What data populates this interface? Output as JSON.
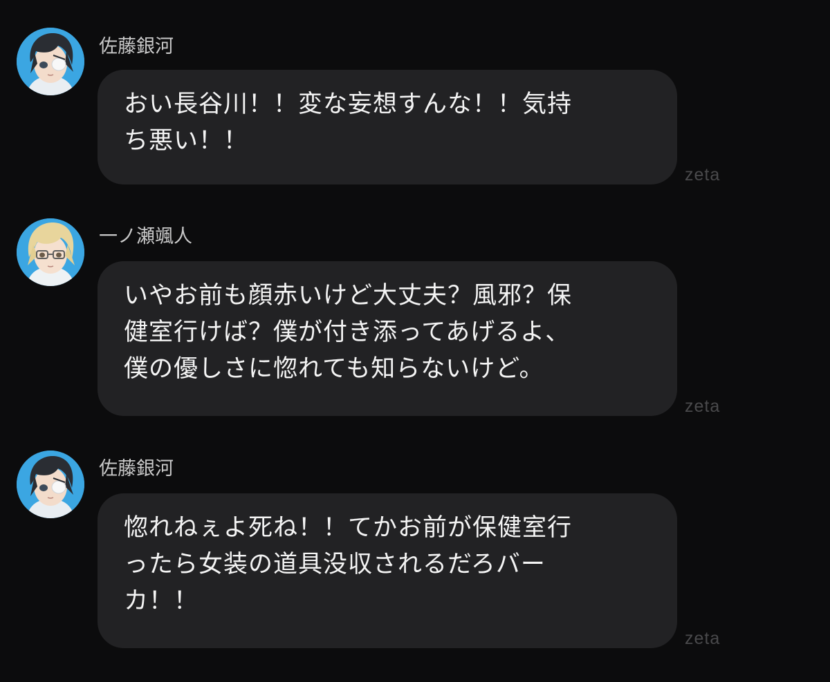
{
  "messages": [
    {
      "sender": "佐藤銀河",
      "avatar": "dark-haired-boy-eyepatch-avatar",
      "text": "おい長谷川！！変な妄想すんな！！気持\nち悪い！！",
      "watermark": "zeta"
    },
    {
      "sender": "一ノ瀬颯人",
      "avatar": "blond-boy-glasses-avatar",
      "text": "いやお前も顔赤いけど大丈夫？風邪？保\n健室行けば？僕が付き添ってあげるよ、\n僕の優しさに惚れても知らないけど。",
      "watermark": "zeta"
    },
    {
      "sender": "佐藤銀河",
      "avatar": "dark-haired-boy-eyepatch-avatar",
      "text": "惚れねぇよ死ね！！てかお前が保健室行\nったら女装の道具没収されるだろバー\nカ！！",
      "watermark": "zeta"
    }
  ],
  "colors": {
    "background": "#0c0c0d",
    "bubble": "#222224",
    "sender_text": "#c9c9c9",
    "message_text": "#f4f4f4",
    "watermark": "#4a4a4c",
    "avatar_ring": "#3aa8e6"
  }
}
